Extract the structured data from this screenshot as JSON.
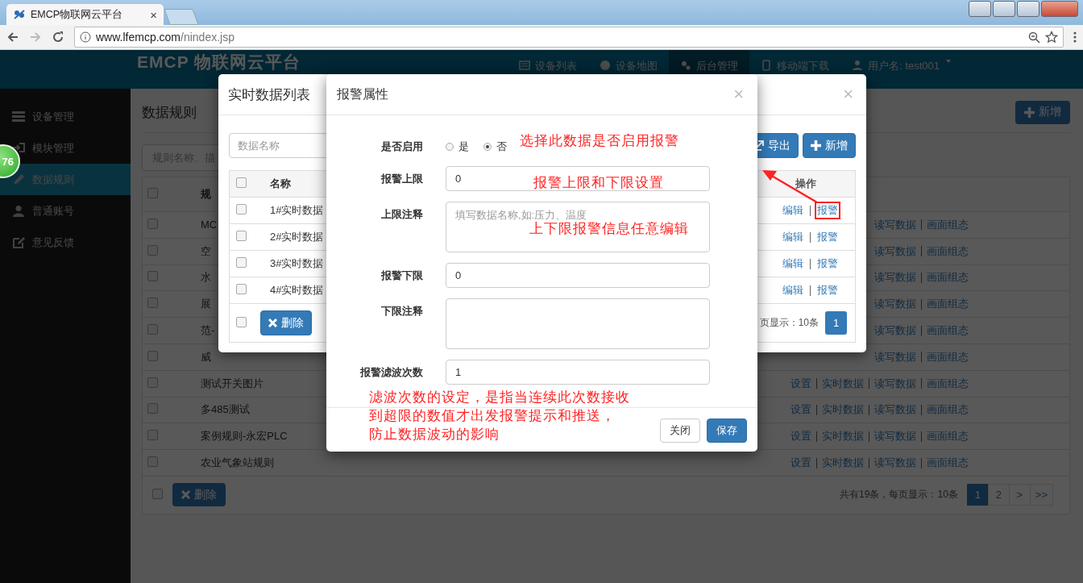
{
  "browser": {
    "tab_title": "EMCP物联网云平台",
    "tab_close": "×",
    "url_host": "www.lfemcp.com",
    "url_path": "/nindex.jsp"
  },
  "header": {
    "logo": "EMCP 物联网云平台",
    "nav": [
      {
        "label": "设备列表",
        "selected": false
      },
      {
        "label": "设备地图",
        "selected": false
      },
      {
        "label": "后台管理",
        "selected": true
      },
      {
        "label": "移动端下载",
        "selected": false
      },
      {
        "label": "用户名: test001",
        "selected": false
      }
    ]
  },
  "floating_badge": "76",
  "sidebar": {
    "items": [
      {
        "label": "设备管理",
        "selected": false
      },
      {
        "label": "模块管理",
        "selected": false
      },
      {
        "label": "数据规则",
        "selected": true
      },
      {
        "label": "普通账号",
        "selected": false
      },
      {
        "label": "意见反馈",
        "selected": false
      }
    ]
  },
  "content": {
    "title": "数据规则",
    "new_button": "新增",
    "search_placeholder": "规则名称、描",
    "table": {
      "column_name": "规",
      "header_checked": false,
      "rows": [
        {
          "name": "MC",
          "checked": false,
          "actions": [
            "读写数据",
            "画面组态"
          ]
        },
        {
          "name": "空",
          "checked": false,
          "actions": [
            "读写数据",
            "画面组态"
          ]
        },
        {
          "name": "水",
          "checked": false,
          "actions": [
            "读写数据",
            "画面组态"
          ]
        },
        {
          "name": "展",
          "checked": false,
          "actions": [
            "读写数据",
            "画面组态"
          ]
        },
        {
          "name": "范-",
          "checked": false,
          "actions": [
            "读写数据",
            "画面组态"
          ]
        },
        {
          "name": "威",
          "checked": false,
          "actions": [
            "读写数据",
            "画面组态"
          ]
        },
        {
          "name": "测试开关图片",
          "checked": false,
          "actions": [
            "设置",
            "实时数据",
            "读写数据",
            "画面组态"
          ]
        },
        {
          "name": "多485测试",
          "checked": false,
          "actions": [
            "设置",
            "实时数据",
            "读写数据",
            "画面组态"
          ]
        },
        {
          "name": "案例规则-永宏PLC",
          "checked": false,
          "actions": [
            "设置",
            "实时数据",
            "读写数据",
            "画面组态"
          ]
        },
        {
          "name": "农业气象站规则",
          "checked": false,
          "actions": [
            "设置",
            "实时数据",
            "读写数据",
            "画面组态"
          ]
        }
      ],
      "footer_checked": false
    },
    "delete_button": "删除",
    "summary": "共有19条，每页显示：10条",
    "pages": [
      {
        "label": "1",
        "selected": true
      },
      {
        "label": "2",
        "selected": false
      },
      {
        "label": ">",
        "selected": false
      },
      {
        "label": ">>",
        "selected": false
      }
    ]
  },
  "list_modal": {
    "title": "实时数据列表",
    "close": "×",
    "search_placeholder": "数据名称",
    "buttons": [
      "导出",
      "新增"
    ],
    "columns": [
      "名称",
      "操作"
    ],
    "header_checked": false,
    "rows": [
      {
        "name": "1#实时数据",
        "checked": false,
        "actions": [
          {
            "label": "编辑",
            "highlighted": false
          },
          {
            "label": "报警",
            "highlighted": true
          }
        ]
      },
      {
        "name": "2#实时数据",
        "checked": false,
        "actions": [
          {
            "label": "编辑",
            "highlighted": false
          },
          {
            "label": "报警",
            "highlighted": false
          }
        ]
      },
      {
        "name": "3#实时数据",
        "checked": false,
        "actions": [
          {
            "label": "编辑",
            "highlighted": false
          },
          {
            "label": "报警",
            "highlighted": false
          }
        ]
      },
      {
        "name": "4#实时数据",
        "checked": false,
        "actions": [
          {
            "label": "编辑",
            "highlighted": false
          },
          {
            "label": "报警",
            "highlighted": false
          }
        ]
      }
    ],
    "footer_checked": false,
    "delete_button": "删除",
    "summary": "页显示：10条",
    "pages": [
      {
        "label": "1",
        "selected": true
      }
    ]
  },
  "alarm_modal": {
    "title": "报警属性",
    "close": "×",
    "fields": [
      {
        "kind": "radio",
        "label": "是否启用",
        "options": [
          {
            "label": "是",
            "selected": false
          },
          {
            "label": "否",
            "selected": true
          }
        ]
      },
      {
        "kind": "input",
        "label": "报警上限",
        "value": "0"
      },
      {
        "kind": "textarea",
        "label": "上限注释",
        "placeholder": "填写数据名称,如:压力、温度"
      },
      {
        "kind": "input",
        "label": "报警下限",
        "value": "0"
      },
      {
        "kind": "textarea",
        "label": "下限注释"
      },
      {
        "kind": "input",
        "label": "报警滤波次数",
        "value": "1"
      }
    ],
    "buttons": [
      {
        "label": "关闭",
        "kind": "default"
      },
      {
        "label": "保存",
        "kind": "primary"
      }
    ]
  },
  "annotations": [
    "选择此数据是否启用报警",
    "报警上限和下限设置",
    "上下限报警信息任意编辑",
    "滤波次数的设定，是指当连续此次数接收",
    "到超限的数值才出发报警提示和推送，",
    "防止数据波动的影响"
  ]
}
